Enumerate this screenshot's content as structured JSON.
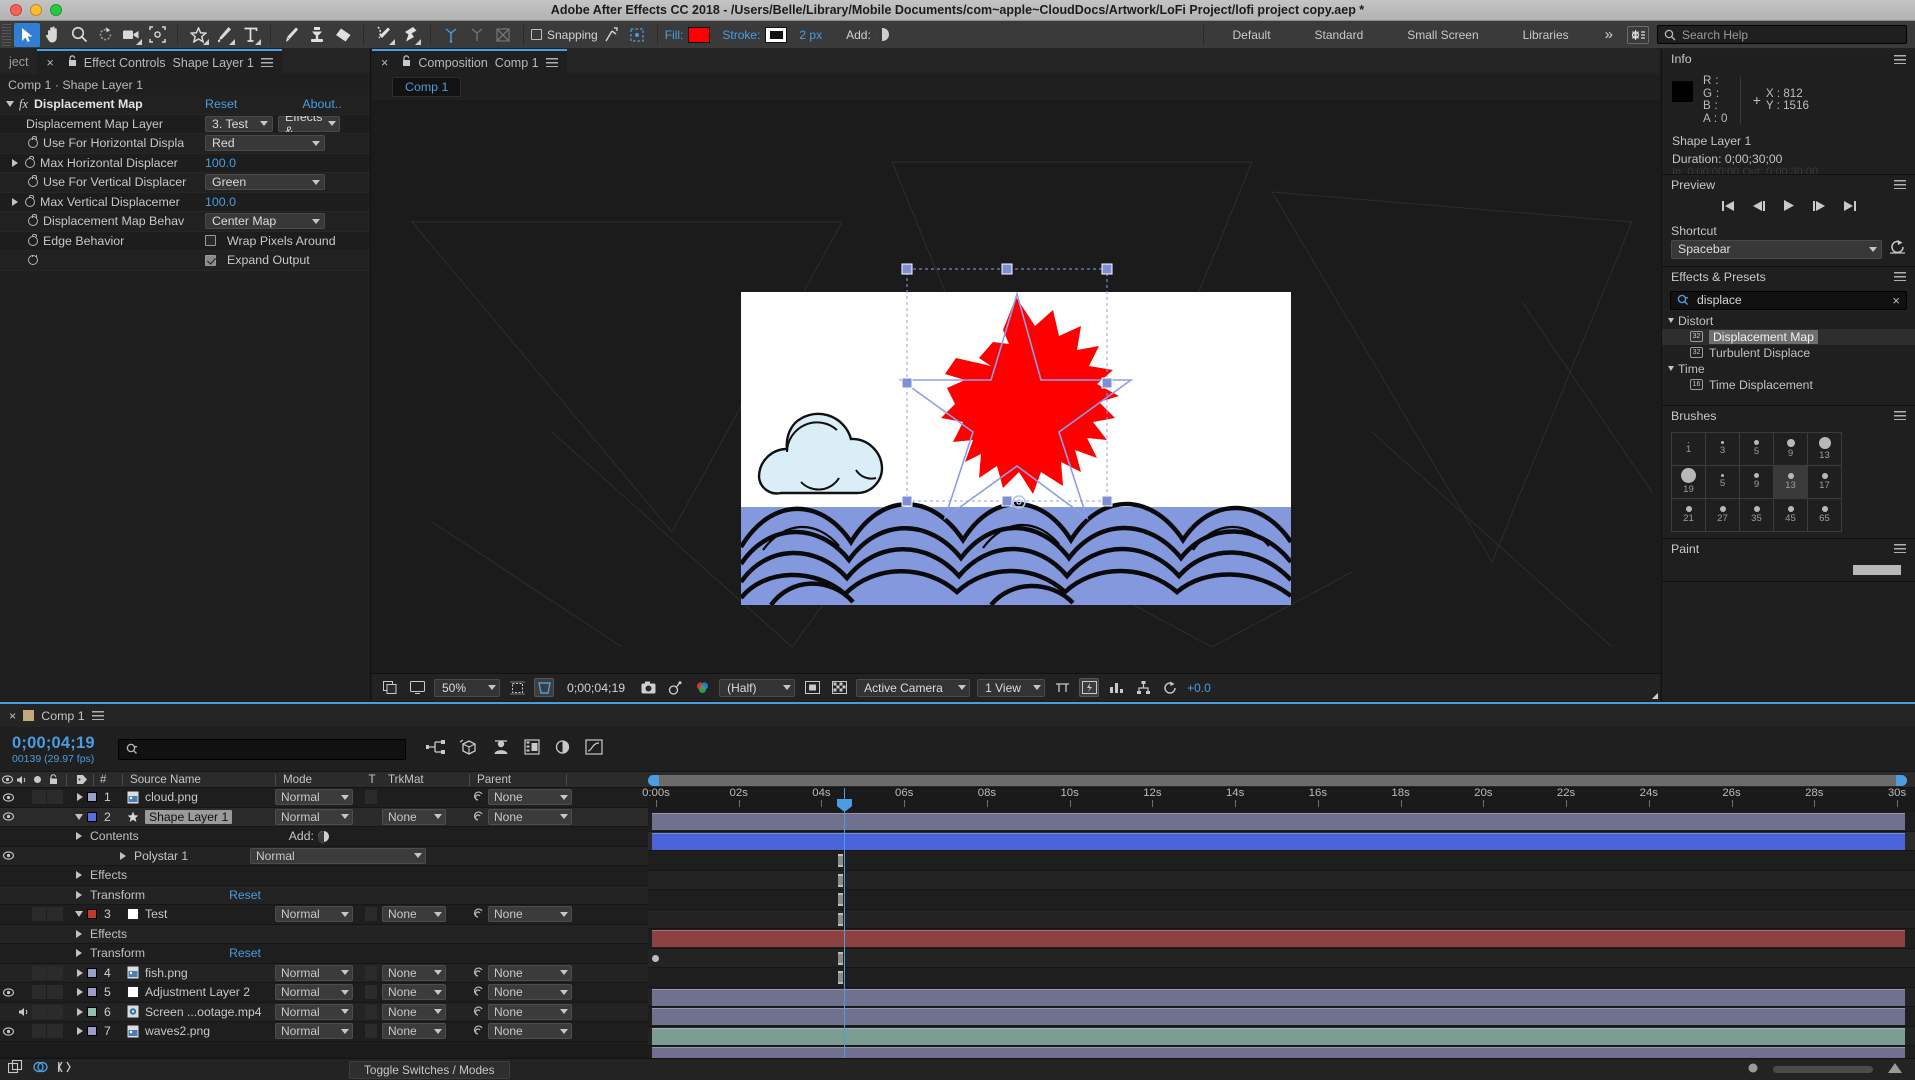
{
  "window": {
    "title": "Adobe After Effects CC 2018 - /Users/Belle/Library/Mobile Documents/com~apple~CloudDocs/Artwork/LoFi Project/lofi project copy.aep *"
  },
  "toolbar": {
    "tools": [
      {
        "name": "selection-tool",
        "icon": "arrow",
        "selected": true
      },
      {
        "name": "hand-tool",
        "icon": "hand",
        "selected": false
      },
      {
        "name": "zoom-tool",
        "icon": "magnifier",
        "selected": false
      },
      {
        "name": "rotation-tool",
        "icon": "rotate",
        "selected": false
      },
      {
        "name": "camera-tool",
        "icon": "camera",
        "selected": false
      },
      {
        "name": "pan-behind-tool",
        "icon": "anchor-region",
        "selected": false
      },
      {
        "name": "shape-tool",
        "icon": "star",
        "selected": false
      },
      {
        "name": "pen-tool",
        "icon": "pen",
        "selected": false
      },
      {
        "name": "type-tool",
        "icon": "text-T",
        "selected": false
      },
      {
        "name": "brush-tool",
        "icon": "brush",
        "selected": false
      },
      {
        "name": "clone-stamp-tool",
        "icon": "stamp",
        "selected": false
      },
      {
        "name": "eraser-tool",
        "icon": "eraser",
        "selected": false
      },
      {
        "name": "roto-brush-tool",
        "icon": "roto-brush",
        "selected": false
      },
      {
        "name": "puppet-pin-tool",
        "icon": "pin",
        "selected": false
      }
    ],
    "snapping_label": "Snapping",
    "fill_label": "Fill:",
    "fill_color": "#ff0000",
    "stroke_label": "Stroke:",
    "stroke_color": "#ffffff",
    "stroke_width": "2 px",
    "add_label": "Add:",
    "workspaces": [
      "Default",
      "Standard",
      "Small Screen",
      "Libraries"
    ],
    "overflow": "»",
    "search_help_placeholder": "Search Help"
  },
  "effect_controls": {
    "tab_inactive": "ject",
    "tab_prefix": "Effect Controls",
    "tab_layer": "Shape Layer 1",
    "breadcrumb": "Comp 1 · Shape Layer 1",
    "effect_name": "Displacement Map",
    "reset_label": "Reset",
    "about_label": "About..",
    "properties": [
      {
        "label": "Displacement Map Layer",
        "value": "3. Test",
        "extra": "Effects &",
        "type": "dropdown-pair"
      },
      {
        "label": "Use For Horizontal Displa",
        "value": "Red",
        "type": "dropdown"
      },
      {
        "label": "Max Horizontal Displacer",
        "value": "100.0",
        "type": "number"
      },
      {
        "label": "Use For Vertical Displacer",
        "value": "Green",
        "type": "dropdown"
      },
      {
        "label": "Max Vertical Displacemer",
        "value": "100.0",
        "type": "number"
      },
      {
        "label": "Displacement Map Behav",
        "value": "Center Map",
        "type": "dropdown"
      },
      {
        "label": "Edge Behavior",
        "value": "Wrap Pixels Around",
        "checked": false,
        "type": "checkbox"
      },
      {
        "label": "",
        "value": "Expand Output",
        "checked": true,
        "type": "checkbox"
      }
    ]
  },
  "composition": {
    "tab_prefix": "Composition",
    "tab_name": "Comp 1",
    "breadcrumb": "Comp 1",
    "footer": {
      "zoom": "50%",
      "timecode": "0;00;04;19",
      "resolution": "(Half)",
      "camera": "Active Camera",
      "views": "1 View",
      "exposure": "+0.0"
    },
    "artwork": {
      "sky_color": "#ffffff",
      "cloud_color": "#d9eef6",
      "wave_color": "#8398dd",
      "star_color": "#ff0000",
      "outline_color": "#8d9ee8"
    }
  },
  "info_panel": {
    "title": "Info",
    "r_label": "R :",
    "r_value": "",
    "g_label": "G :",
    "g_value": "",
    "b_label": "B :",
    "b_value": "",
    "a_label": "A :",
    "a_value": "0",
    "x_label": "X :",
    "x_value": "812",
    "y_label": "Y :",
    "y_value": "1516",
    "layer_name": "Shape Layer 1",
    "duration": "Duration: 0;00;30;00"
  },
  "preview_panel": {
    "title": "Preview",
    "shortcut_label": "Shortcut",
    "shortcut_value": "Spacebar",
    "buttons": [
      "first-frame",
      "prev-frame",
      "play",
      "next-frame",
      "last-frame"
    ]
  },
  "effects_presets": {
    "title": "Effects & Presets",
    "search_value": "displace",
    "groups": [
      {
        "name": "Distort",
        "items": [
          {
            "label": "Displacement Map",
            "badge": "32",
            "selected": true
          },
          {
            "label": "Turbulent Displace",
            "badge": "32",
            "selected": false
          }
        ]
      },
      {
        "name": "Time",
        "items": [
          {
            "label": "Time Displacement",
            "badge": "16",
            "selected": false
          }
        ]
      }
    ]
  },
  "brushes_panel": {
    "title": "Brushes",
    "cells": [
      {
        "num": "1",
        "size": 1,
        "sel": false
      },
      {
        "num": "3",
        "size": 3,
        "sel": false
      },
      {
        "num": "5",
        "size": 5,
        "sel": false
      },
      {
        "num": "9",
        "size": 8,
        "sel": false
      },
      {
        "num": "13",
        "size": 12,
        "sel": false
      },
      {
        "num": "19",
        "size": 15,
        "sel": false
      },
      {
        "num": "5",
        "size": 3,
        "sel": false
      },
      {
        "num": "9",
        "size": 5,
        "sel": false
      },
      {
        "num": "13",
        "size": 6,
        "sel": true
      },
      {
        "num": "17",
        "size": 6,
        "sel": false
      },
      {
        "num": "21",
        "size": 6,
        "sel": false
      },
      {
        "num": "27",
        "size": 6,
        "sel": false
      },
      {
        "num": "35",
        "size": 6,
        "sel": false
      },
      {
        "num": "45",
        "size": 6,
        "sel": false
      },
      {
        "num": "65",
        "size": 6,
        "sel": false
      }
    ]
  },
  "paint_panel": {
    "title": "Paint"
  },
  "timeline": {
    "tab_name": "Comp 1",
    "current_time": "0;00;04;19",
    "frame_info": "00139 (29.97 fps)",
    "search_placeholder": "",
    "columns": [
      "#",
      "Source Name",
      "Mode",
      "T",
      "TrkMat",
      "Parent"
    ],
    "toggle_switches_label": "Toggle Switches / Modes",
    "ruler_labels": [
      "0:00s",
      "02s",
      "04s",
      "06s",
      "08s",
      "10s",
      "12s",
      "14s",
      "16s",
      "18s",
      "20s",
      "22s",
      "24s",
      "26s",
      "28s",
      "30s"
    ],
    "rows": [
      {
        "kind": "layer",
        "index": "1",
        "name": "cloud.png",
        "icon": "image",
        "mode": "Normal",
        "trkmat": "",
        "parent": "None",
        "eye": true,
        "audio": false,
        "color": "#9a9ec7",
        "bar": "#70718e",
        "selected": false,
        "expanded": false
      },
      {
        "kind": "layer",
        "index": "2",
        "name": "Shape Layer 1",
        "icon": "star",
        "mode": "Normal",
        "trkmat": "None",
        "parent": "None",
        "eye": true,
        "audio": false,
        "color": "#5a6ee0",
        "bar": "#4a63d8",
        "selected": true,
        "expanded": true
      },
      {
        "kind": "group",
        "label": "Contents",
        "add_label": "Add:",
        "indent": 2
      },
      {
        "kind": "sub",
        "label": "Polystar 1",
        "mode": "Normal",
        "indent": 3,
        "eye": true
      },
      {
        "kind": "group",
        "label": "Effects",
        "indent": 2
      },
      {
        "kind": "group",
        "label": "Transform",
        "reset": "Reset",
        "indent": 2
      },
      {
        "kind": "layer",
        "index": "3",
        "name": "Test",
        "icon": "solid",
        "mode": "Normal",
        "trkmat": "None",
        "parent": "None",
        "eye": false,
        "audio": false,
        "color": "#c0392b",
        "bar": "#8e4141",
        "selected": false,
        "expanded": true
      },
      {
        "kind": "group",
        "label": "Effects",
        "indent": 2,
        "keyframe": true
      },
      {
        "kind": "group",
        "label": "Transform",
        "reset": "Reset",
        "indent": 2
      },
      {
        "kind": "layer",
        "index": "4",
        "name": "fish.png",
        "icon": "image",
        "mode": "Normal",
        "trkmat": "None",
        "parent": "None",
        "eye": false,
        "audio": false,
        "color": "#9a9ec7",
        "bar": "#70718e",
        "selected": false,
        "expanded": false
      },
      {
        "kind": "layer",
        "index": "5",
        "name": "Adjustment Layer 2",
        "icon": "solid",
        "mode": "Normal",
        "trkmat": "None",
        "parent": "None",
        "eye": true,
        "audio": false,
        "color": "#9a9ec7",
        "bar": "#70718e",
        "selected": false,
        "expanded": false
      },
      {
        "kind": "layer",
        "index": "6",
        "name": "Screen ...ootage.mp4",
        "icon": "video",
        "mode": "Normal",
        "trkmat": "None",
        "parent": "None",
        "eye": false,
        "audio": true,
        "color": "#8fc0b4",
        "bar": "#7d9c94",
        "selected": false,
        "expanded": false
      },
      {
        "kind": "layer",
        "index": "7",
        "name": "waves2.png",
        "icon": "image",
        "mode": "Normal",
        "trkmat": "None",
        "parent": "None",
        "eye": true,
        "audio": false,
        "color": "#9a9ec7",
        "bar": "#70718e",
        "selected": false,
        "expanded": false
      }
    ]
  }
}
